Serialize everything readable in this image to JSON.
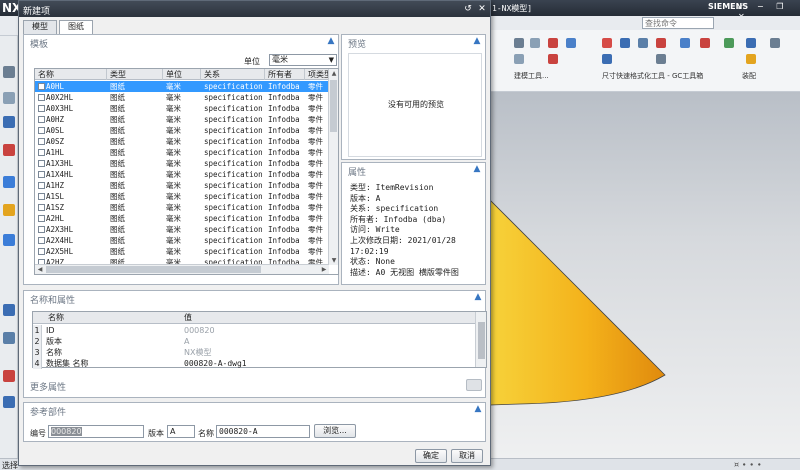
{
  "app": {
    "logo": "NX",
    "window_title": "1-NX模型]",
    "search_placeholder": "查找命令",
    "brand": "SIEMENS",
    "ribbon_groups": [
      "建模工具...",
      "尺寸快速格式化工具 - GC工具箱",
      "装配"
    ],
    "status_text": "选择",
    "status_right": "¤  ∙  ∙  ∙"
  },
  "dialog": {
    "title": "新建项",
    "tabs": [
      "模型",
      "图纸"
    ],
    "active_tab": 1,
    "template_section": {
      "title": "模板",
      "unit_label": "单位",
      "unit_value": "毫米",
      "columns": [
        "名称",
        "类型",
        "单位",
        "关系",
        "所有者",
        "项类型"
      ],
      "rows": [
        [
          "A0HL",
          "图纸",
          "毫米",
          "specification",
          "Infodba",
          "零件"
        ],
        [
          "A0X2HL",
          "图纸",
          "毫米",
          "specification",
          "Infodba",
          "零件"
        ],
        [
          "A0X3HL",
          "图纸",
          "毫米",
          "specification",
          "Infodba",
          "零件"
        ],
        [
          "A0HZ",
          "图纸",
          "毫米",
          "specification",
          "Infodba",
          "零件"
        ],
        [
          "A0SL",
          "图纸",
          "毫米",
          "specification",
          "Infodba",
          "零件"
        ],
        [
          "A0SZ",
          "图纸",
          "毫米",
          "specification",
          "Infodba",
          "零件"
        ],
        [
          "A1HL",
          "图纸",
          "毫米",
          "specification",
          "Infodba",
          "零件"
        ],
        [
          "A1X3HL",
          "图纸",
          "毫米",
          "specification",
          "Infodba",
          "零件"
        ],
        [
          "A1X4HL",
          "图纸",
          "毫米",
          "specification",
          "Infodba",
          "零件"
        ],
        [
          "A1HZ",
          "图纸",
          "毫米",
          "specification",
          "Infodba",
          "零件"
        ],
        [
          "A1SL",
          "图纸",
          "毫米",
          "specification",
          "Infodba",
          "零件"
        ],
        [
          "A1SZ",
          "图纸",
          "毫米",
          "specification",
          "Infodba",
          "零件"
        ],
        [
          "A2HL",
          "图纸",
          "毫米",
          "specification",
          "Infodba",
          "零件"
        ],
        [
          "A2X3HL",
          "图纸",
          "毫米",
          "specification",
          "Infodba",
          "零件"
        ],
        [
          "A2X4HL",
          "图纸",
          "毫米",
          "specification",
          "Infodba",
          "零件"
        ],
        [
          "A2X5HL",
          "图纸",
          "毫米",
          "specification",
          "Infodba",
          "零件"
        ],
        [
          "A2HZ",
          "图纸",
          "毫米",
          "specification",
          "Infodba",
          "零件"
        ]
      ],
      "selected_row": 0
    },
    "preview_section": {
      "title": "预览",
      "empty_text": "没有可用的预览"
    },
    "properties_section": {
      "title": "属性",
      "lines": [
        "类型: ItemRevision",
        "版本: A",
        "关系: specification",
        "所有者: Infodba (dba)",
        "访问: Write",
        "上次修改日期: 2021/01/28",
        "17:02:19",
        "状态: None",
        "描述: A0 无视图 横版零件图"
      ]
    },
    "name_attrs_section": {
      "title": "名称和属性",
      "columns": [
        "名称",
        "值"
      ],
      "rows": [
        {
          "num": "1",
          "name": "ID",
          "value": "000820"
        },
        {
          "num": "2",
          "name": "版本",
          "value": "A"
        },
        {
          "num": "3",
          "name": "名称",
          "value": "NX模型"
        },
        {
          "num": "4",
          "name": "数据集 名称",
          "value": "000820-A-dwg1"
        }
      ],
      "more_attrs_label": "更多属性"
    },
    "reference_section": {
      "title": "参考部件",
      "id_label": "编号",
      "id_value": "000820",
      "version_label": "版本",
      "version_value": "A",
      "name_label": "名称",
      "name_value": "000820-A",
      "browse_button": "浏览..."
    },
    "ok_button": "确定",
    "cancel_button": "取消"
  }
}
